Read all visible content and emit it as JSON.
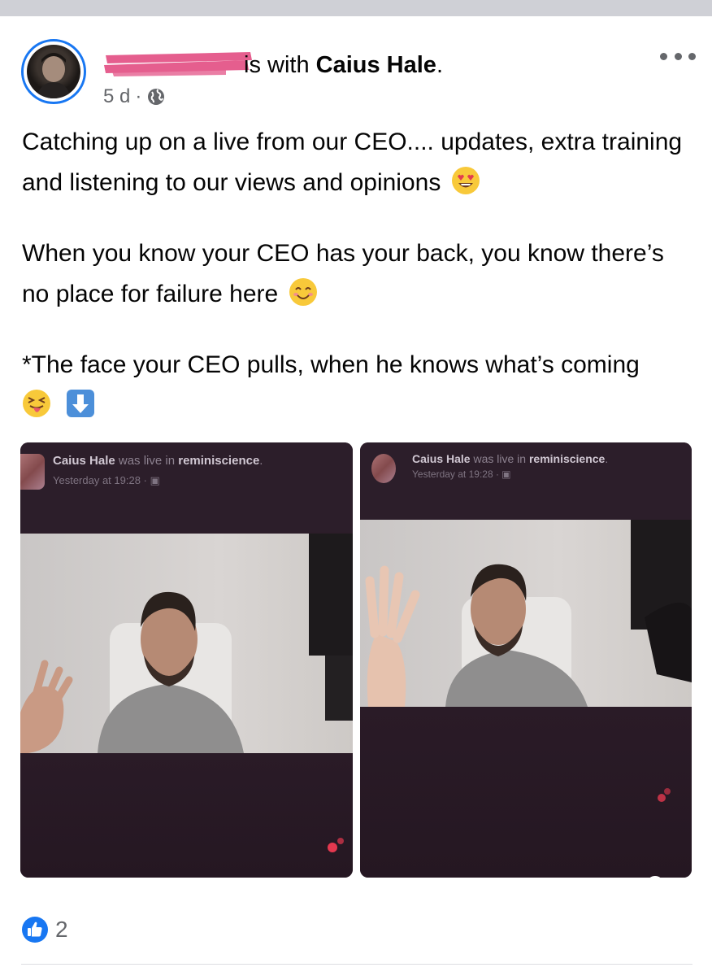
{
  "post": {
    "author_with_prefix": "is with ",
    "tagged_user": "Caius Hale",
    "author_suffix": ".",
    "timestamp": "5 d",
    "separator": "·",
    "privacy_icon": "globe-icon",
    "more_icon": "more-options-icon",
    "paragraphs": [
      {
        "text": "Catching up on a live from our CEO.... updates, extra training and listening to our views and opinions",
        "emoji": "heart-eyes-emoji"
      },
      {
        "text": "When you know your CEO has your back, you know there’s no place for failure here",
        "emoji": "smiling-face-emoji"
      },
      {
        "text": "*The face your CEO pulls, when he knows what’s coming",
        "emoji": "squinting-tongue-emoji",
        "emoji2": "down-arrow-emoji"
      }
    ]
  },
  "photos": [
    {
      "name": "Caius Hale",
      "was_live": " was live in ",
      "group": "reminiscience",
      "period": ".",
      "time": "Yesterday at 19:28 · "
    },
    {
      "name": "Caius Hale",
      "was_live": " was live in ",
      "group": "reminiscience",
      "period": ".",
      "time": "Yesterday at 19:28 · "
    }
  ],
  "reactions": {
    "icon": "like-icon",
    "count": "2"
  },
  "colors": {
    "accent": "#1877f2",
    "text": "#050505",
    "secondary": "#65676b",
    "redaction": "#e85c8c"
  }
}
